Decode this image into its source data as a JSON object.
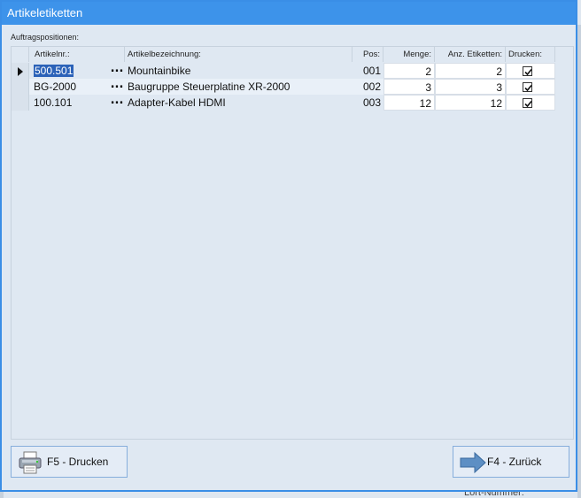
{
  "window": {
    "title": "Artikeletiketten"
  },
  "group": {
    "label": "Auftragspositionen:"
  },
  "table": {
    "columns": {
      "artikelnr": "Artikelnr.:",
      "bezeichnung": "Artikelbezeichnung:",
      "pos": "Pos:",
      "menge": "Menge:",
      "etiketten": "Anz. Etiketten:",
      "drucken": "Drucken:"
    },
    "rows": [
      {
        "artikelnr": "500.501",
        "dots": "...",
        "bezeichnung": "Mountainbike",
        "pos": "001",
        "menge": "2",
        "etiketten": "2",
        "drucken": true,
        "current": true
      },
      {
        "artikelnr": "BG-2000",
        "dots": "...",
        "bezeichnung": "Baugruppe Steuerplatine XR-2000",
        "pos": "002",
        "menge": "3",
        "etiketten": "3",
        "drucken": true,
        "current": false
      },
      {
        "artikelnr": "100.101",
        "dots": "...",
        "bezeichnung": "Adapter-Kabel HDMI",
        "pos": "003",
        "menge": "12",
        "etiketten": "12",
        "drucken": true,
        "current": false
      }
    ]
  },
  "buttons": {
    "print": {
      "label": "F5 - Drucken",
      "icon": "printer-icon"
    },
    "back": {
      "label": "F4 - Zurück",
      "icon": "arrow-right-icon"
    }
  },
  "background": {
    "footer_text": "Lort-Nummer:"
  }
}
